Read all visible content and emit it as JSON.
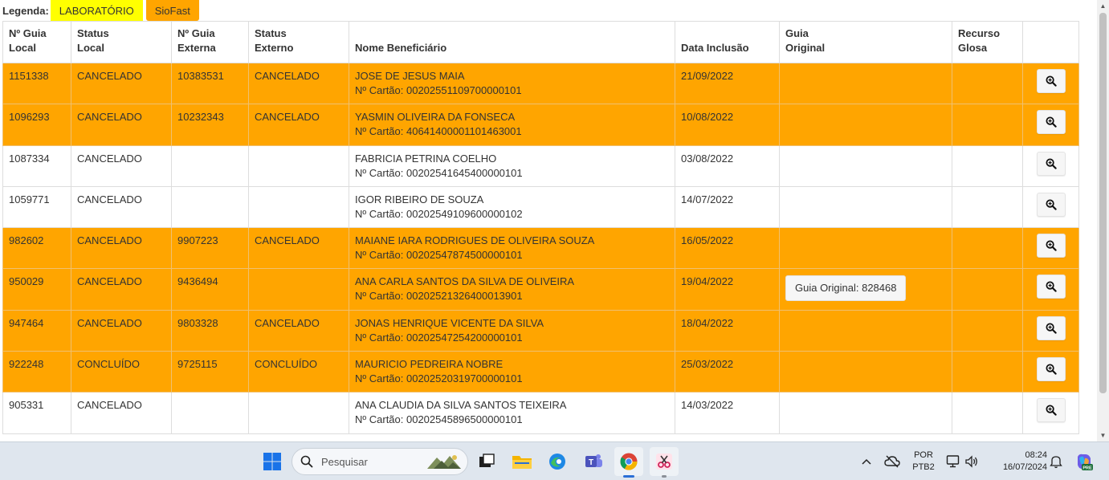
{
  "legend": {
    "label": "Legenda:",
    "items": [
      {
        "text": "LABORATÓRIO",
        "color": "#ffff00"
      },
      {
        "text": "SioFast",
        "color": "#ffa500"
      }
    ]
  },
  "table": {
    "headers": {
      "guia_local": [
        "Nº Guia",
        "Local"
      ],
      "status_local": [
        "Status",
        "Local"
      ],
      "guia_externa": [
        "Nº Guia",
        "Externa"
      ],
      "status_externo": [
        "Status",
        "Externo"
      ],
      "nome": "Nome Beneficiário",
      "data": "Data Inclusão",
      "guia_original": [
        "Guia",
        "Original"
      ],
      "recurso": [
        "Recurso",
        "Glosa"
      ]
    },
    "row_colors": {
      "orange": "#ffa500",
      "white": "#ffffff"
    },
    "rows": [
      {
        "guia_local": "1151338",
        "status_local": "CANCELADO",
        "guia_externa": "10383531",
        "status_externo": "CANCELADO",
        "nome": "JOSE DE JESUS MAIA",
        "cartao": "Nº Cartão: 00202551109700000101",
        "data": "21/09/2022",
        "guia_original": ""
      },
      {
        "guia_local": "1096293",
        "status_local": "CANCELADO",
        "guia_externa": "10232343",
        "status_externo": "CANCELADO",
        "nome": "YASMIN OLIVEIRA DA FONSECA",
        "cartao": "Nº Cartão: 40641400001101463001",
        "data": "10/08/2022",
        "guia_original": ""
      },
      {
        "guia_local": "1087334",
        "status_local": "CANCELADO",
        "guia_externa": "",
        "status_externo": "",
        "nome": "FABRICIA PETRINA COELHO",
        "cartao": "Nº Cartão: 00202541645400000101",
        "data": "03/08/2022",
        "guia_original": ""
      },
      {
        "guia_local": "1059771",
        "status_local": "CANCELADO",
        "guia_externa": "",
        "status_externo": "",
        "nome": "IGOR RIBEIRO DE SOUZA",
        "cartao": "Nº Cartão: 00202549109600000102",
        "data": "14/07/2022",
        "guia_original": ""
      },
      {
        "guia_local": "982602",
        "status_local": "CANCELADO",
        "guia_externa": "9907223",
        "status_externo": "CANCELADO",
        "nome": "MAIANE IARA RODRIGUES DE OLIVEIRA SOUZA",
        "cartao": "Nº Cartão: 00202547874500000101",
        "data": "16/05/2022",
        "guia_original": ""
      },
      {
        "guia_local": "950029",
        "status_local": "CANCELADO",
        "guia_externa": "9436494",
        "status_externo": "",
        "nome": "ANA CARLA SANTOS DA SILVA DE OLIVEIRA",
        "cartao": "Nº Cartão: 00202521326400013901",
        "data": "19/04/2022",
        "guia_original": "Guia Original: 828468"
      },
      {
        "guia_local": "947464",
        "status_local": "CANCELADO",
        "guia_externa": "9803328",
        "status_externo": "CANCELADO",
        "nome": "JONAS HENRIQUE VICENTE DA SILVA",
        "cartao": "Nº Cartão: 00202547254200000101",
        "data": "18/04/2022",
        "guia_original": ""
      },
      {
        "guia_local": "922248",
        "status_local": "CONCLUÍDO",
        "guia_externa": "9725115",
        "status_externo": "CONCLUÍDO",
        "nome": "MAURICIO PEDREIRA NOBRE",
        "cartao": "Nº Cartão: 00202520319700000101",
        "data": "25/03/2022",
        "guia_original": ""
      },
      {
        "guia_local": "905331",
        "status_local": "CANCELADO",
        "guia_externa": "",
        "status_externo": "",
        "nome": "ANA CLAUDIA DA SILVA SANTOS TEIXEIRA",
        "cartao": "Nº Cartão: 00202545896500000101",
        "data": "14/03/2022",
        "guia_original": ""
      }
    ]
  },
  "taskbar": {
    "search_placeholder": "Pesquisar",
    "language": "POR",
    "keyboard": "PTB2",
    "time": "08:24",
    "date": "16/07/2024",
    "apps": [
      "windows-start-icon",
      "task-view-icon",
      "file-explorer-icon",
      "edge-icon",
      "teams-icon",
      "chrome-icon",
      "snipping-tool-icon"
    ],
    "accent": "#2b6fd6"
  }
}
